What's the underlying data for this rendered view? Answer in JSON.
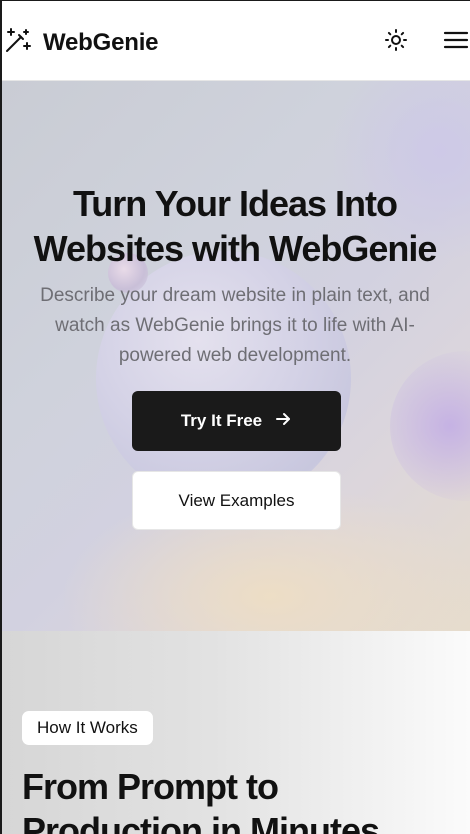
{
  "header": {
    "brand_name": "WebGenie",
    "brand_icon": "magic-wand-icon",
    "theme_icon": "sun-icon",
    "menu_icon": "hamburger-menu-icon"
  },
  "hero": {
    "title": "Turn Your Ideas Into Websites with WebGenie",
    "subtitle": "Describe your dream website in plain text, and watch as WebGenie brings it to life with AI-powered web development.",
    "primary_button": "Try It Free",
    "primary_button_icon": "arrow-right-icon",
    "secondary_button": "View Examples"
  },
  "how_it_works": {
    "badge": "How It Works",
    "title": "From Prompt to Production in Minutes"
  },
  "colors": {
    "primary_button_bg": "#1a1a1a",
    "text": "#111111",
    "muted_text": "#6e6e74"
  }
}
